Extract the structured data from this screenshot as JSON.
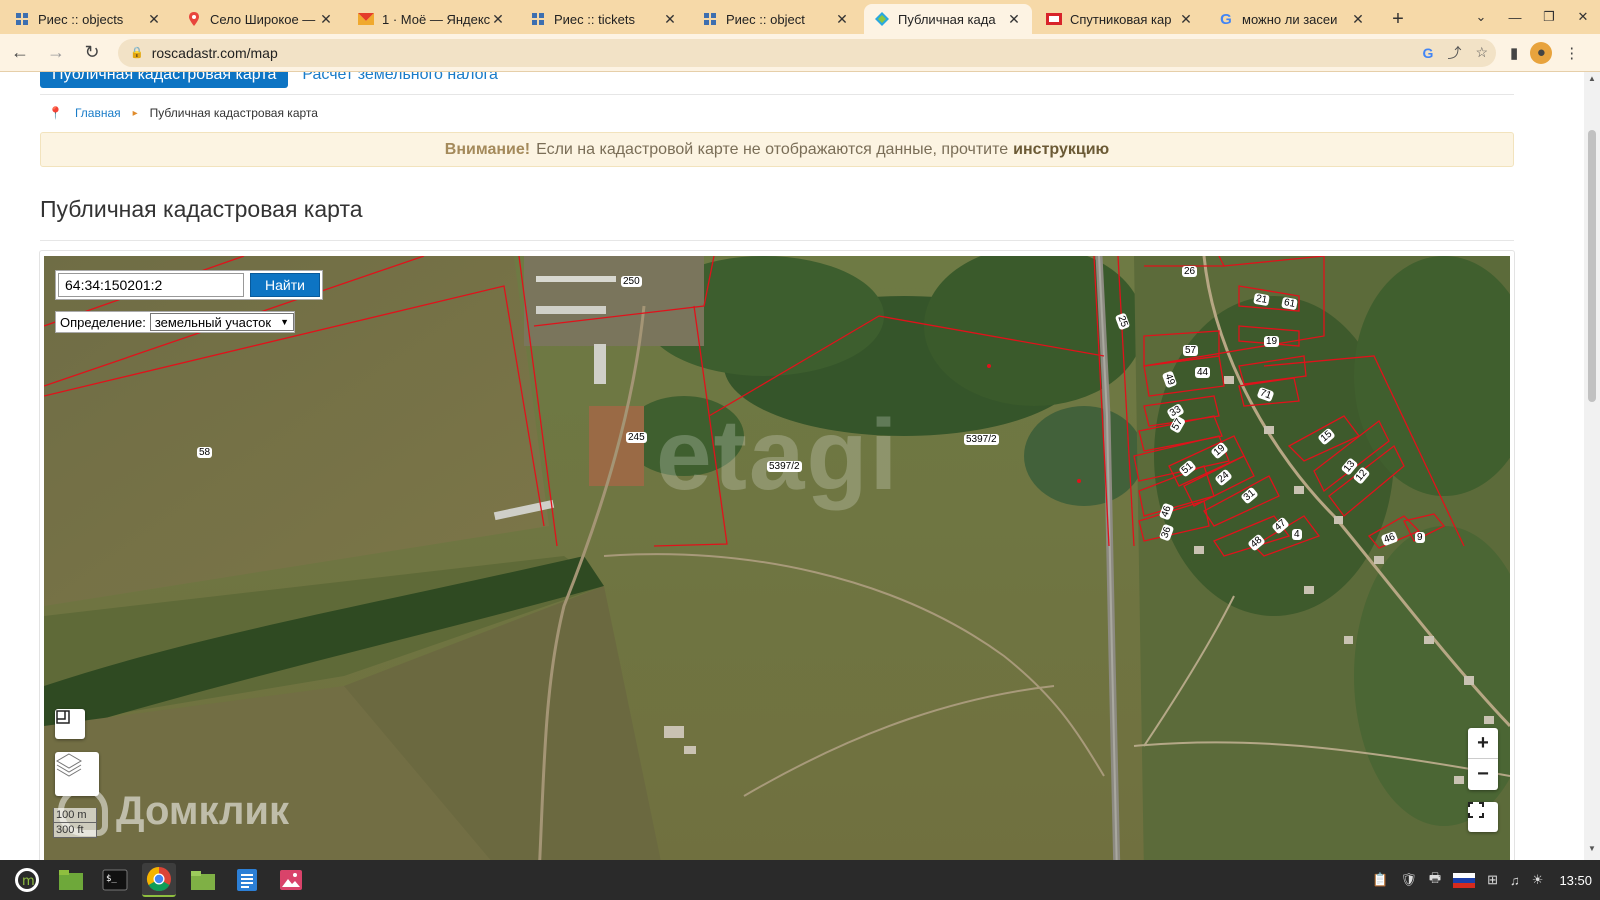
{
  "browser": {
    "tabs": [
      {
        "title": "Риес :: objects",
        "icon": "grid-favicon-icon",
        "active": false
      },
      {
        "title": "Село Широкое —",
        "icon": "maps-pin-favicon-icon",
        "active": false
      },
      {
        "title": "1 · Моё — Яндекс",
        "icon": "mail-favicon-icon",
        "active": false
      },
      {
        "title": "Риес :: tickets",
        "icon": "grid-favicon-icon",
        "active": false
      },
      {
        "title": "Риес :: object",
        "icon": "grid-favicon-icon",
        "active": false
      },
      {
        "title": "Публичная када",
        "icon": "cadastre-favicon-icon",
        "active": true
      },
      {
        "title": "Спутниковая кар",
        "icon": "satellite-favicon-icon",
        "active": false
      },
      {
        "title": "можно ли засеи",
        "icon": "google-favicon-icon",
        "active": false
      }
    ],
    "url": "roscadastr.com/map"
  },
  "site": {
    "nav_active": "Публичная кадастровая карта",
    "nav_link": "Расчет земельного налога",
    "breadcrumb_home": "Главная",
    "breadcrumb_current": "Публичная кадастровая карта",
    "alert_strong": "Внимание!",
    "alert_text": "Если на кадастровой карте не отображаются данные, прочтите",
    "alert_link": "инструкцию",
    "page_title": "Публичная кадастровая карта"
  },
  "map": {
    "search_value": "64:34:150201:2",
    "search_button": "Найти",
    "definition_label": "Определение:",
    "definition_value": "земельный участок",
    "zoom_in": "+",
    "zoom_out": "−",
    "scale_metric": "100 m",
    "scale_imperial": "300 ft",
    "watermark": "etagi",
    "brand": "Домклик",
    "parcel_labels": [
      "250",
      "245",
      "58",
      "5397/2",
      "5397/2",
      "25",
      "26",
      "21",
      "61",
      "19",
      "57",
      "44",
      "49",
      "71",
      "33",
      "57",
      "15",
      "19",
      "51",
      "24",
      "13",
      "12",
      "31",
      "46",
      "47",
      "4",
      "48",
      "36",
      "46",
      "9"
    ]
  },
  "taskbar": {
    "clock": "13:50",
    "apps": [
      "menu-icon",
      "files-green-icon",
      "terminal-icon",
      "chrome-icon",
      "folder-icon",
      "text-editor-icon",
      "image-viewer-icon"
    ]
  },
  "colors": {
    "tabstrip": "#f6d9a8",
    "primary_blue": "#0d74c3",
    "parcel_red": "#e0121b",
    "alert_bg": "#fcf4e2"
  }
}
